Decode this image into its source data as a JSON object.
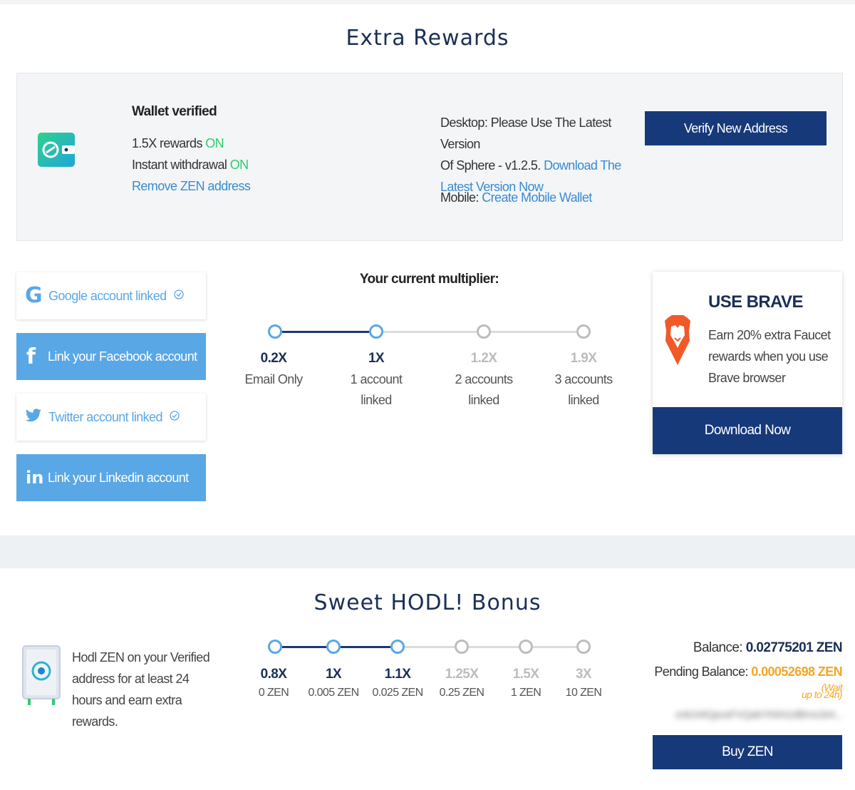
{
  "extra_rewards": {
    "title": "Extra Rewards"
  },
  "wallet": {
    "heading": "Wallet verified",
    "rewards_label": "1.5X rewards",
    "rewards_status": "ON",
    "withdrawal_label": "Instant withdrawal",
    "withdrawal_status": "ON",
    "remove_link": "Remove ZEN address",
    "desktop_line1": "Desktop: Please Use The Latest Version",
    "desktop_line2": "Of Sphere - v1.2.5.",
    "download_link_a": "Download The",
    "download_link_b": "Latest Version Now",
    "mobile_label": "Mobile:",
    "mobile_link": "Create Mobile Wallet",
    "verify_button": "Verify New Address"
  },
  "social": {
    "google": "Google account linked",
    "facebook": "Link your Facebook account",
    "twitter": "Twitter account linked",
    "linkedin": "Link your Linkedin account"
  },
  "multiplier": {
    "title": "Your current multiplier:",
    "steps": [
      {
        "value": "0.2X",
        "desc1": "Email Only",
        "desc2": "",
        "active": true
      },
      {
        "value": "1X",
        "desc1": "1 account",
        "desc2": "linked",
        "active": true
      },
      {
        "value": "1.2X",
        "desc1": "2 accounts",
        "desc2": "linked",
        "active": false
      },
      {
        "value": "1.9X",
        "desc1": "3 accounts",
        "desc2": "linked",
        "active": false
      }
    ]
  },
  "brave": {
    "title": "USE BRAVE",
    "line1": "Earn 20% extra Faucet",
    "line2": "rewards when you use",
    "line3": "Brave browser",
    "button": "Download Now"
  },
  "hodl": {
    "title": "Sweet HODL! Bonus",
    "desc1": "Hodl ZEN on your Verified",
    "desc2": "address for at least 24",
    "desc3": "hours and earn extra",
    "desc4": "rewards.",
    "steps": [
      {
        "value": "0.8X",
        "sub": "0 ZEN",
        "active": true
      },
      {
        "value": "1X",
        "sub": "0.005 ZEN",
        "active": true
      },
      {
        "value": "1.1X",
        "sub": "0.025 ZEN",
        "active": true
      },
      {
        "value": "1.25X",
        "sub": "0.25 ZEN",
        "active": false
      },
      {
        "value": "1.5X",
        "sub": "1 ZEN",
        "active": false
      },
      {
        "value": "3X",
        "sub": "10 ZEN",
        "active": false
      }
    ],
    "balance_label": "Balance:",
    "balance_value": "0.02775201 ZEN",
    "pending_label": "Pending Balance:",
    "pending_value": "0.00052698 ZEN",
    "pending_note1": "(Wait",
    "pending_note2": "up to 24h)",
    "address_blurred": "znb1WQpvsFVQabYKkN1dBms1b4...",
    "buy_button": "Buy ZEN"
  },
  "colors": {
    "navy": "#16397a",
    "link_blue": "#3a8bd1",
    "on_green": "#2ecc71",
    "social_blue": "#5aa7e6",
    "pending_orange": "#f5a623"
  }
}
